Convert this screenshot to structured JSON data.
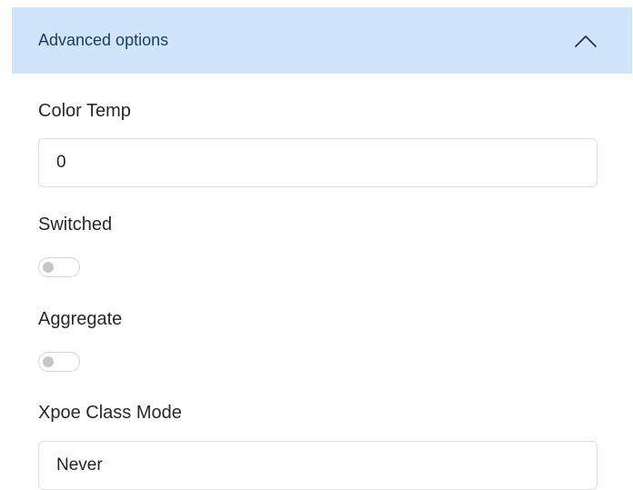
{
  "accordion": {
    "title": "Advanced options",
    "expanded": true,
    "icon": "chevron-up-icon",
    "header_bg": "#d0e4fb"
  },
  "fields": {
    "color_temp": {
      "label": "Color Temp",
      "value": "0"
    },
    "switched": {
      "label": "Switched",
      "checked": false
    },
    "aggregate": {
      "label": "Aggregate",
      "checked": false
    },
    "xpoe_class_mode": {
      "label": "Xpoe Class Mode",
      "value": "Never"
    }
  }
}
